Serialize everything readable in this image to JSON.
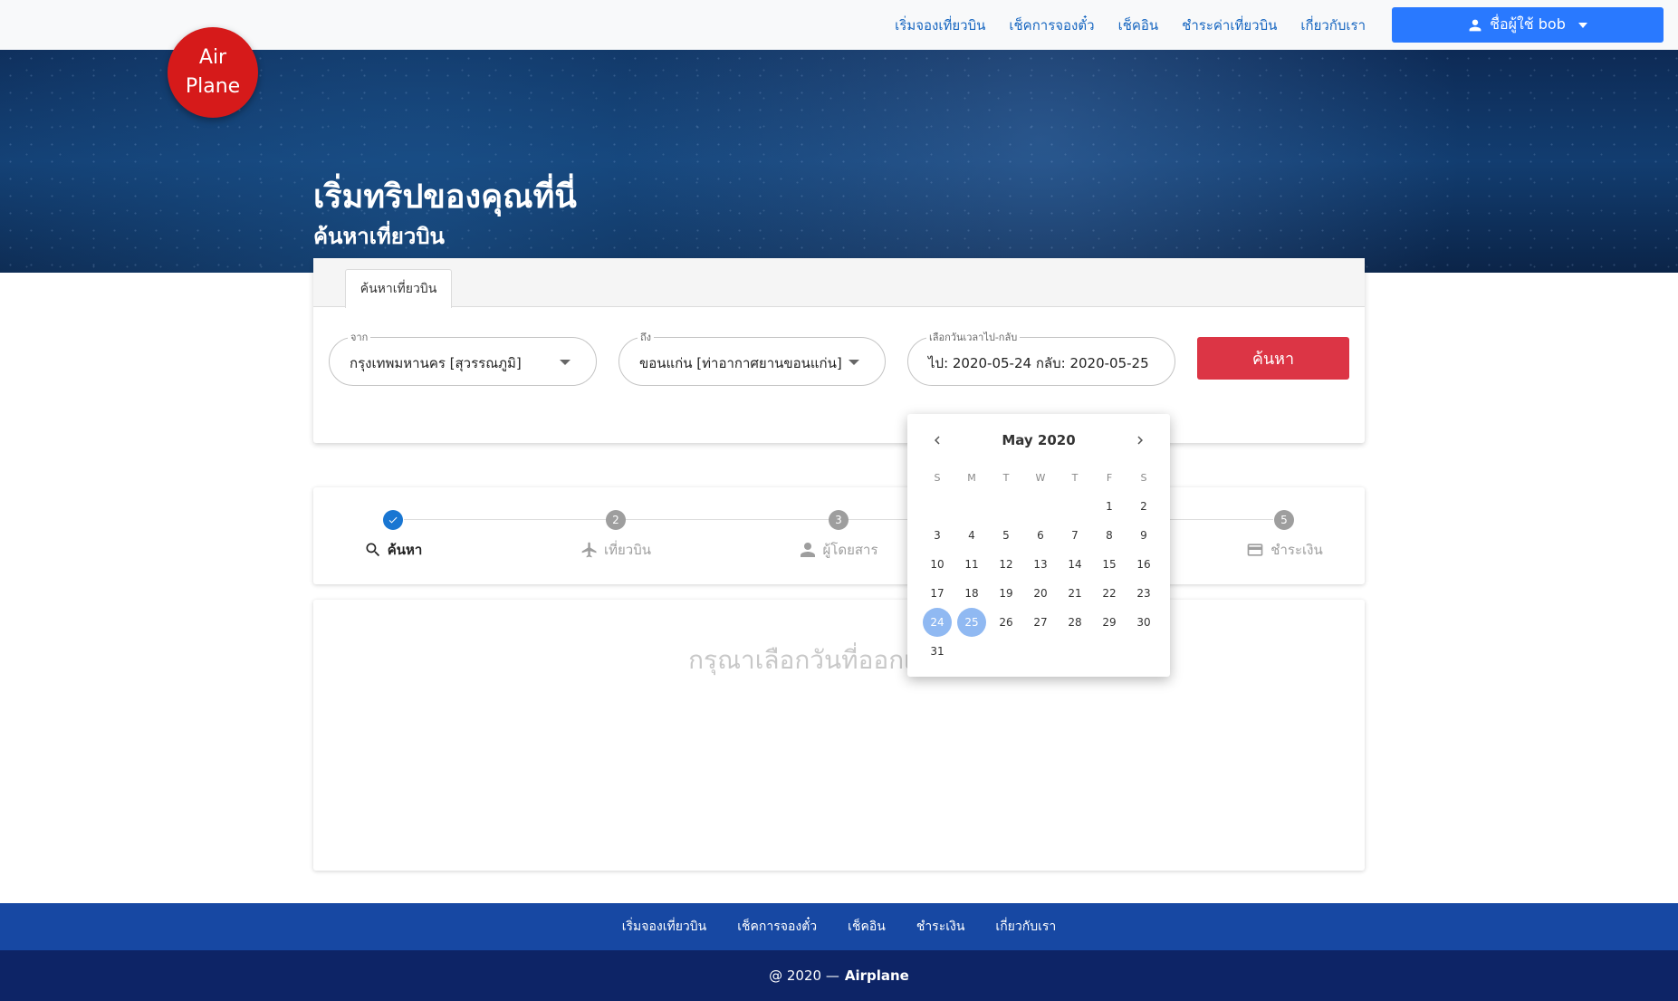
{
  "nav": {
    "links": [
      "เริ่มจองเที่ยวบิน",
      "เช็คการจองตั๋ว",
      "เช็คอิน",
      "ชำระค่าเที่ยวบิน",
      "เกี่ยวกับเรา"
    ],
    "user_label": "ชื่อผู้ใช้ bob",
    "user_icon": "person-icon"
  },
  "logo": {
    "line1": "Air",
    "line2": "Plane"
  },
  "hero": {
    "title": "เริ่มทริปของคุณที่นี่",
    "subtitle": "ค้นหาเที่ยวบิน"
  },
  "search": {
    "tab": "ค้นหาเที่ยวบิน",
    "from": {
      "label": "จาก",
      "value": "กรุงเทพมหานคร [สุวรรณภูมิ]"
    },
    "to": {
      "label": "ถึง",
      "value": "ขอนแก่น [ท่าอากาศยานขอนแก่น]"
    },
    "dates": {
      "label": "เลือกวันเวลาไป-กลับ",
      "value": "ไป: 2020-05-24 กลับ: 2020-05-25"
    },
    "button": "ค้นหา",
    "button_color": "#dc3545"
  },
  "datepicker": {
    "month": "May 2020",
    "weekdays": [
      "S",
      "M",
      "T",
      "W",
      "T",
      "F",
      "S"
    ],
    "leading_blanks": 5,
    "days_in_month": 31,
    "selected": [
      24,
      25
    ],
    "selected_color": "#90b9f2"
  },
  "stepper": {
    "steps": [
      {
        "number": "",
        "label": "ค้นหา",
        "icon": "search-icon",
        "state": "done"
      },
      {
        "number": "2",
        "label": "เที่ยวบิน",
        "icon": "airplane-icon",
        "state": "pending"
      },
      {
        "number": "3",
        "label": "ผู้โดยสาร",
        "icon": "person-icon",
        "state": "pending"
      },
      {
        "number": "5",
        "label": "ชำระเงิน",
        "icon": "credit-card-icon",
        "state": "pending"
      }
    ]
  },
  "results": {
    "hint": "กรุณาเลือกวันที่ออกเดินทาง"
  },
  "footer": {
    "links": [
      "เริ่มจองเที่ยวบิน",
      "เช็คการจองตั๋ว",
      "เช็คอิน",
      "ชำระเงิน",
      "เกี่ยวกับเรา"
    ],
    "copyright": "@ 2020 —",
    "brand": "Airplane"
  }
}
